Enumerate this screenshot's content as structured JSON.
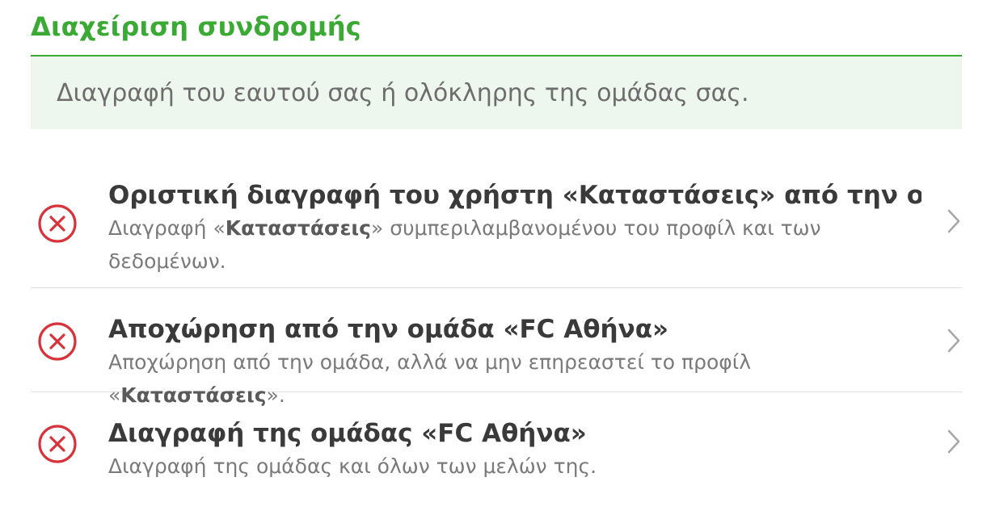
{
  "header": {
    "title": "Διαχείριση συνδρομής",
    "subtitle": "Διαγραφή του εαυτού σας ή ολόκληρης της ομάδας σας."
  },
  "rows": [
    {
      "title": "Οριστική διαγραφή του χρήστη «Καταστάσεις» από την ομάδα «...",
      "desc_prefix": "Διαγραφή «",
      "desc_bold": "Καταστάσεις",
      "desc_suffix": "» συμπεριλαμβανομένου του προφίλ και των δεδομένων.",
      "icon": "remove-circle-icon"
    },
    {
      "title": "Αποχώρηση από την ομάδα «FC Αθήνα»",
      "desc_prefix": "Αποχώρηση από την ομάδα, αλλά να μην επηρεαστεί το προφίλ «",
      "desc_bold": "Καταστάσεις",
      "desc_suffix": "».",
      "icon": "remove-circle-icon"
    },
    {
      "title": "Διαγραφή της ομάδας «FC Αθήνα»",
      "desc_prefix": "Διαγραφή της ομάδας και όλων των μελών της.",
      "desc_bold": "",
      "desc_suffix": "",
      "icon": "remove-circle-icon"
    }
  ],
  "colors": {
    "accent": "#3aaa35",
    "danger": "#d8333a",
    "info_bg": "#eef7ee"
  }
}
